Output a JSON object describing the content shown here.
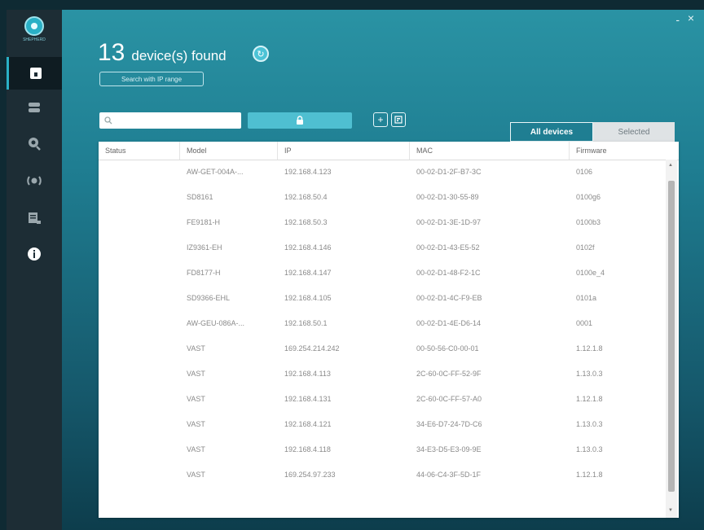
{
  "window": {
    "minimize": "-",
    "close": "×"
  },
  "sidebar": {
    "logo_text": "SHEPHERD",
    "items": [
      {
        "icon": "home-icon",
        "active": true
      },
      {
        "icon": "device-icon",
        "active": false
      },
      {
        "icon": "settings-icon",
        "active": false
      },
      {
        "icon": "network-icon",
        "active": false
      },
      {
        "icon": "report-icon",
        "active": false
      },
      {
        "icon": "info-icon",
        "active": false
      }
    ]
  },
  "header": {
    "count": "13",
    "count_text": "device(s) found",
    "range_button": "Search with IP range"
  },
  "toolbar": {
    "search_placeholder": "",
    "tabs": [
      "All devices",
      "Selected"
    ]
  },
  "table": {
    "columns": [
      "Status",
      "Model",
      "IP",
      "MAC",
      "Firmware"
    ],
    "rows": [
      [
        "",
        "AW-GET-004A-...",
        "192.168.4.123",
        "00-02-D1-2F-B7-3C",
        "0106"
      ],
      [
        "",
        "SD8161",
        "192.168.50.4",
        "00-02-D1-30-55-89",
        "0100g6"
      ],
      [
        "",
        "FE9181-H",
        "192.168.50.3",
        "00-02-D1-3E-1D-97",
        "0100b3"
      ],
      [
        "",
        "IZ9361-EH",
        "192.168.4.146",
        "00-02-D1-43-E5-52",
        "0102f"
      ],
      [
        "",
        "FD8177-H",
        "192.168.4.147",
        "00-02-D1-48-F2-1C",
        "0100e_4"
      ],
      [
        "",
        "SD9366-EHL",
        "192.168.4.105",
        "00-02-D1-4C-F9-EB",
        "0101a"
      ],
      [
        "",
        "AW-GEU-086A-...",
        "192.168.50.1",
        "00-02-D1-4E-D6-14",
        "0001"
      ],
      [
        "",
        "VAST",
        "169.254.214.242",
        "00-50-56-C0-00-01",
        "1.12.1.8"
      ],
      [
        "",
        "VAST",
        "192.168.4.113",
        "2C-60-0C-FF-52-9F",
        "1.13.0.3"
      ],
      [
        "",
        "VAST",
        "192.168.4.131",
        "2C-60-0C-FF-57-A0",
        "1.12.1.8"
      ],
      [
        "",
        "VAST",
        "192.168.4.121",
        "34-E6-D7-24-7D-C6",
        "1.13.0.3"
      ],
      [
        "",
        "VAST",
        "192.168.4.118",
        "34-E3-D5-E3-09-9E",
        "1.13.0.3"
      ],
      [
        "",
        "VAST",
        "169.254.97.233",
        "44-06-C4-3F-5D-1F",
        "1.12.1.8"
      ]
    ]
  }
}
